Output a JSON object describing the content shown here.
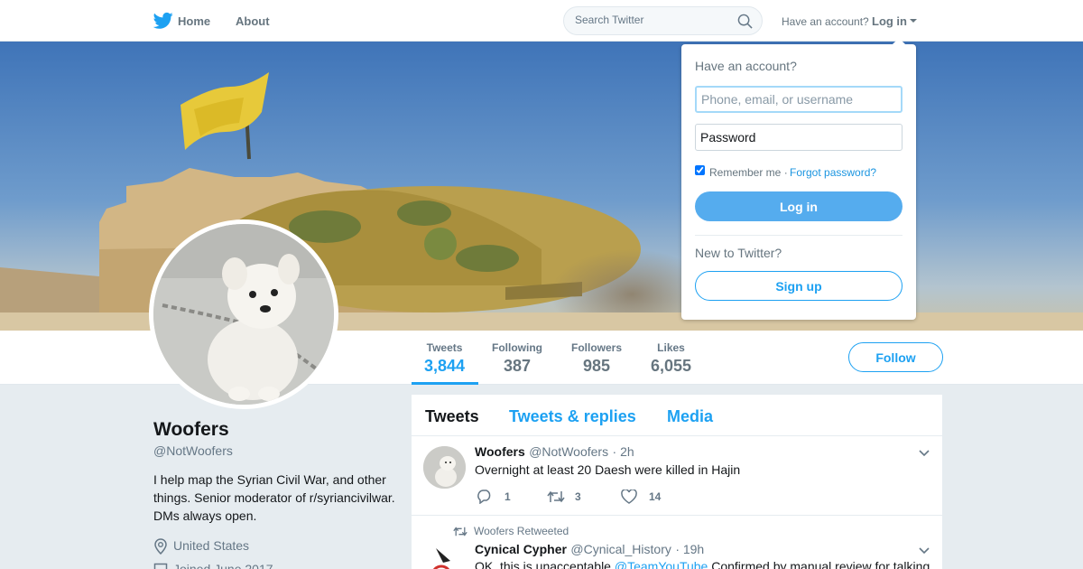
{
  "nav": {
    "home_label": "Home",
    "about_label": "About",
    "search_placeholder": "Search Twitter",
    "have_account": "Have an account?",
    "login_label": "Log in"
  },
  "colors": {
    "brand": "#1da1f2",
    "login_button": "#55acee"
  },
  "icons": [
    "twitter-bird-icon",
    "search-icon",
    "chevron-down-icon",
    "location-pin-icon",
    "calendar-icon",
    "reply-icon",
    "retweet-icon",
    "like-icon"
  ],
  "profile": {
    "name": "Woofers",
    "handle": "@NotWoofers",
    "bio": "I help map the Syrian Civil War, and other things. Senior moderator of r/syriancivilwar. DMs always open.",
    "location": "United States",
    "joined": "Joined June 2017"
  },
  "stats": [
    {
      "label": "Tweets",
      "value": "3,844"
    },
    {
      "label": "Following",
      "value": "387"
    },
    {
      "label": "Followers",
      "value": "985"
    },
    {
      "label": "Likes",
      "value": "6,055"
    }
  ],
  "follow_label": "Follow",
  "timeline": {
    "tabs": [
      "Tweets",
      "Tweets & replies",
      "Media"
    ],
    "tweets": [
      {
        "name": "Woofers",
        "handle": "@NotWoofers",
        "time": "· 2h",
        "text": "Overnight at least 20 Daesh were killed in Hajin",
        "replies": "1",
        "retweets": "3",
        "likes": "14"
      },
      {
        "context": "Woofers Retweeted",
        "name": "Cynical Cypher",
        "handle": "@Cynical_History",
        "time": "· 19h",
        "text_start": "OK, this is unacceptable ",
        "mention": "@TeamYouTube",
        "text_end": " Confirmed by manual review for talking"
      }
    ]
  },
  "login_dropdown": {
    "title": "Have an account?",
    "username_placeholder": "Phone, email, or username",
    "password_placeholder": "Password",
    "remember_label": "Remember me ·",
    "remember_checked": true,
    "forgot_label": "Forgot password?",
    "login_button": "Log in",
    "new_label": "New to Twitter?",
    "signup_button": "Sign up"
  }
}
